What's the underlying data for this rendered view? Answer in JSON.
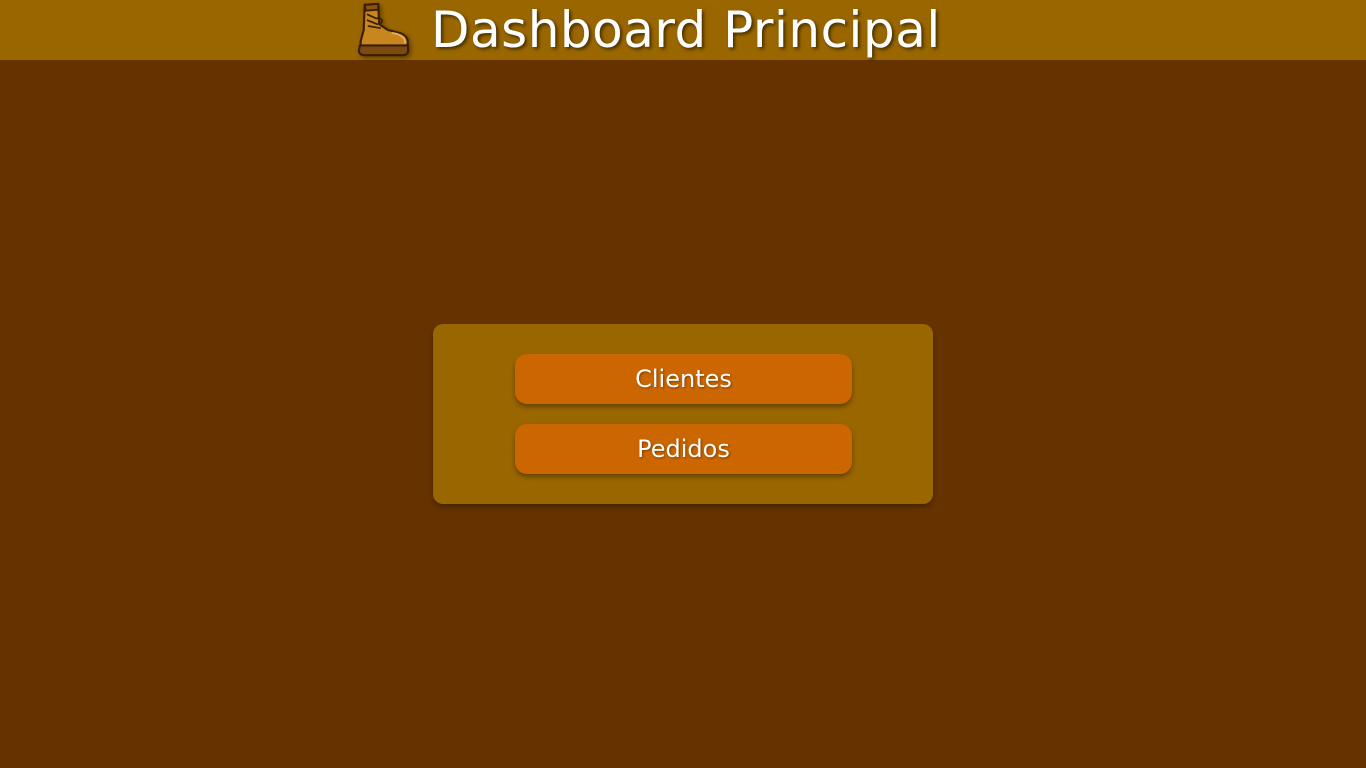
{
  "header": {
    "title": "Dashboard Principal",
    "logo_icon": "boot-icon"
  },
  "menu": {
    "buttons": [
      {
        "label": "Clientes"
      },
      {
        "label": "Pedidos"
      }
    ]
  },
  "colors": {
    "background": "#663300",
    "header": "#996600",
    "panel": "#996600",
    "button": "#cc6600",
    "text": "#ffffff"
  }
}
